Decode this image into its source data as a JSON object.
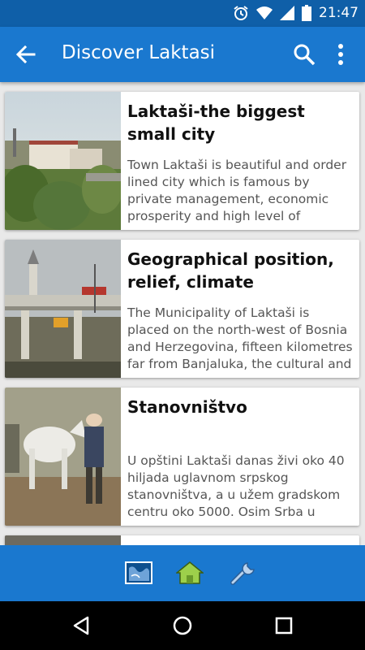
{
  "status_bar": {
    "time": "21:47"
  },
  "app_bar": {
    "title": "Discover Laktasi"
  },
  "articles": [
    {
      "title": "Laktaši-the biggest small city",
      "text": "Town Laktaši is beautiful and order lined city which is famous by private management, economic prosperity and high level of"
    },
    {
      "title": "Geographical position, relief, climate",
      "text": "The Municipality of Laktaši is placed on the north-west of Bosnia and Herzegovina, fifteen kilometres far from Banjaluka, the cultural and"
    },
    {
      "title": "Stanovništvo",
      "text": "U opštini Laktaši danas živi oko 40 hiljada uglavnom srpskog stanovništva, a u užem gradskom centru oko 5000. Osim Srba u"
    }
  ],
  "bottom_tabs": [
    {
      "icon": "map-icon"
    },
    {
      "icon": "home-icon"
    },
    {
      "icon": "wrench-icon"
    }
  ],
  "colors": {
    "status_bar": "#0f5fa8",
    "app_bar": "#1a78cf",
    "background": "#e9e9e9"
  }
}
